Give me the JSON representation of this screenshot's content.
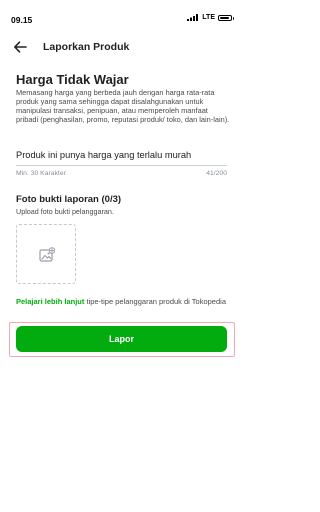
{
  "status_bar": {
    "time": "09.15",
    "network": "LTE",
    "battery_level": 0.85
  },
  "header": {
    "title": "Laporkan Produk"
  },
  "report_reason": {
    "title": "Harga Tidak Wajar",
    "description": "Memasang harga yang berbeda jauh dengan harga rata-rata produk yang sama sehingga dapat disalahgunakan untuk manipulasi transaksi, penipuan, atau memperoleh manfaat pribadi (penghasilan, promo, reputasi produk/ toko, dan lain-lain)."
  },
  "detail_input": {
    "value": "Produk ini punya harga yang terlalu murah",
    "helper_min": "Min. 30 Karakter",
    "counter": "41/200"
  },
  "photo_upload": {
    "title": "Foto bukti laporan (0/3)",
    "subtitle": "Upload foto bukti pelanggaran.",
    "icon": "add-image-icon"
  },
  "learn_more": {
    "link_text": "Pelajari lebih lanjut",
    "text": " tipe-tipe pelanggaran produk di Tokopedia"
  },
  "submit": {
    "label": "Lapor"
  },
  "colors": {
    "primary": "#03ac0e",
    "highlight_border": "#f4a8b3"
  }
}
